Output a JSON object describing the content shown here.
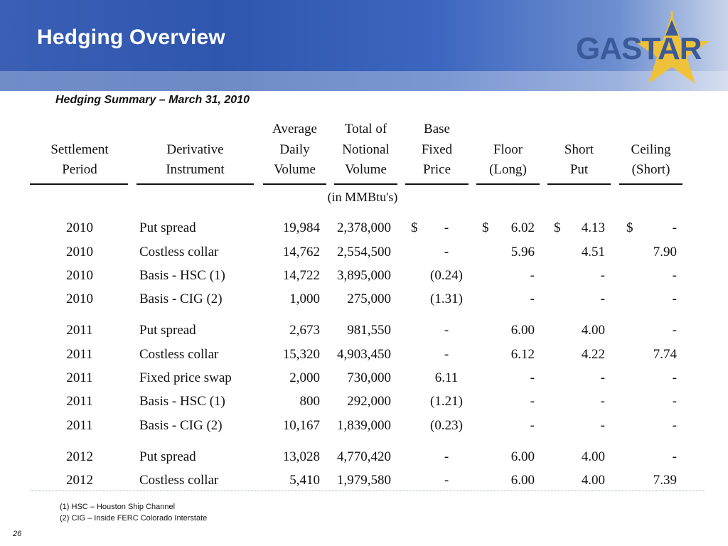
{
  "slide": {
    "title": "Hedging Overview",
    "subtitle": "Hedging Summary – March 31, 2010",
    "page_number": "26",
    "logo_text": "GASTAR"
  },
  "table": {
    "headers": [
      {
        "line1": "",
        "line2": "Settlement",
        "line3": "Period"
      },
      {
        "line1": "",
        "line2": "Derivative",
        "line3": "Instrument"
      },
      {
        "line1": "Average",
        "line2": "Daily",
        "line3": "Volume"
      },
      {
        "line1": "Total of",
        "line2": "Notional",
        "line3": "Volume"
      },
      {
        "line1": "Base",
        "line2": "Fixed",
        "line3": "Price"
      },
      {
        "line1": "",
        "line2": "Floor",
        "line3": "(Long)"
      },
      {
        "line1": "",
        "line2": "Short",
        "line3": "Put"
      },
      {
        "line1": "",
        "line2": "Ceiling",
        "line3": "(Short)"
      }
    ],
    "units_note": "(in MMBtu's)",
    "rows": [
      {
        "period": "2010",
        "instrument": "Put spread",
        "daily": "19,984",
        "notional": "2,378,000",
        "base_cur": "$",
        "base": "-",
        "floor_cur": "$",
        "floor": "6.02",
        "short_cur": "$",
        "short": "4.13",
        "ceil_cur": "$",
        "ceiling": "-"
      },
      {
        "period": "2010",
        "instrument": "Costless collar",
        "daily": "14,762",
        "notional": "2,554,500",
        "base_cur": "",
        "base": "-",
        "floor_cur": "",
        "floor": "5.96",
        "short_cur": "",
        "short": "4.51",
        "ceil_cur": "",
        "ceiling": "7.90"
      },
      {
        "period": "2010",
        "instrument": "Basis - HSC (1)",
        "daily": "14,722",
        "notional": "3,895,000",
        "base_cur": "",
        "base": "(0.24)",
        "floor_cur": "",
        "floor": "-",
        "short_cur": "",
        "short": "-",
        "ceil_cur": "",
        "ceiling": "-"
      },
      {
        "period": "2010",
        "instrument": "Basis - CIG (2)",
        "daily": "1,000",
        "notional": "275,000",
        "base_cur": "",
        "base": "(1.31)",
        "floor_cur": "",
        "floor": "-",
        "short_cur": "",
        "short": "-",
        "ceil_cur": "",
        "ceiling": "-"
      },
      {
        "period": "2011",
        "instrument": "Put spread",
        "daily": "2,673",
        "notional": "981,550",
        "base_cur": "",
        "base": "-",
        "floor_cur": "",
        "floor": "6.00",
        "short_cur": "",
        "short": "4.00",
        "ceil_cur": "",
        "ceiling": "-"
      },
      {
        "period": "2011",
        "instrument": "Costless collar",
        "daily": "15,320",
        "notional": "4,903,450",
        "base_cur": "",
        "base": "-",
        "floor_cur": "",
        "floor": "6.12",
        "short_cur": "",
        "short": "4.22",
        "ceil_cur": "",
        "ceiling": "7.74"
      },
      {
        "period": "2011",
        "instrument": "Fixed price swap",
        "daily": "2,000",
        "notional": "730,000",
        "base_cur": "",
        "base": "6.11",
        "floor_cur": "",
        "floor": "-",
        "short_cur": "",
        "short": "-",
        "ceil_cur": "",
        "ceiling": "-"
      },
      {
        "period": "2011",
        "instrument": "Basis - HSC (1)",
        "daily": "800",
        "notional": "292,000",
        "base_cur": "",
        "base": "(1.21)",
        "floor_cur": "",
        "floor": "-",
        "short_cur": "",
        "short": "-",
        "ceil_cur": "",
        "ceiling": "-"
      },
      {
        "period": "2011",
        "instrument": "Basis - CIG (2)",
        "daily": "10,167",
        "notional": "1,839,000",
        "base_cur": "",
        "base": "(0.23)",
        "floor_cur": "",
        "floor": "-",
        "short_cur": "",
        "short": "-",
        "ceil_cur": "",
        "ceiling": "-"
      },
      {
        "period": "2012",
        "instrument": "Put spread",
        "daily": "13,028",
        "notional": "4,770,420",
        "base_cur": "",
        "base": "-",
        "floor_cur": "",
        "floor": "6.00",
        "short_cur": "",
        "short": "4.00",
        "ceil_cur": "",
        "ceiling": "-"
      },
      {
        "period": "2012",
        "instrument": "Costless collar",
        "daily": "5,410",
        "notional": "1,979,580",
        "base_cur": "",
        "base": "-",
        "floor_cur": "",
        "floor": "6.00",
        "short_cur": "",
        "short": "4.00",
        "ceil_cur": "",
        "ceiling": "7.39"
      }
    ]
  },
  "footnotes": [
    "(1)  HSC – Houston Ship Channel",
    "(2)  CIG – Inside FERC Colorado Interstate"
  ],
  "colors": {
    "header_blue": "#2f56ae",
    "logo_blue": "#3b5a9a",
    "logo_gold": "#f2c230"
  }
}
